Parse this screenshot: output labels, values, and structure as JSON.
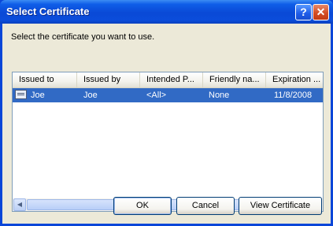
{
  "window": {
    "title": "Select Certificate",
    "help_glyph": "?",
    "close_glyph": "✕"
  },
  "prompt": "Select the certificate you want to use.",
  "columns": [
    "Issued to",
    "Issued by",
    "Intended P...",
    "Friendly na...",
    "Expiration ..."
  ],
  "rows": [
    {
      "issued_to": "Joe",
      "issued_by": "Joe",
      "intended": "<All>",
      "friendly": "None",
      "expiration": "11/8/2008",
      "selected": true
    }
  ],
  "scrollbar": {
    "left_arrow": "◀",
    "right_arrow": "▶"
  },
  "buttons": {
    "ok": "OK",
    "cancel": "Cancel",
    "view": "View Certificate"
  },
  "colors": {
    "selection": "#316AC5",
    "title_bar": "#0A49D6",
    "dialog_bg": "#ECE9D8"
  }
}
